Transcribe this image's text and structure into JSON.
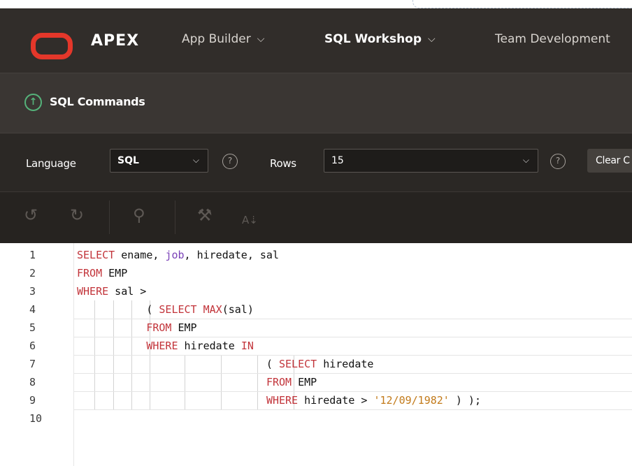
{
  "header": {
    "brand": "APEX",
    "nav": [
      {
        "label": "App Builder",
        "chevron": "⌵"
      },
      {
        "label": "SQL Workshop",
        "chevron": "⌵"
      },
      {
        "label": "Team Development"
      }
    ]
  },
  "breadcrumb": {
    "title": "SQL Commands",
    "icon": "arrow-up-circle-icon"
  },
  "toolbar": {
    "language_label": "Language",
    "language_value": "SQL",
    "rows_label": "Rows",
    "rows_value": "15",
    "clear_label": "Clear C",
    "help_glyph": "?"
  },
  "editor_toolbar": {
    "icons": [
      "undo-icon",
      "redo-icon",
      "search-icon",
      "hammer-icon",
      "sort-az-icon"
    ],
    "format_glyph": "A⇣"
  },
  "editor": {
    "lines": [
      {
        "n": "1",
        "segments": [
          [
            "kw",
            "SELECT"
          ],
          [
            "t",
            " ename, "
          ],
          [
            "col",
            "job"
          ],
          [
            "t",
            ", hiredate, sal"
          ]
        ]
      },
      {
        "n": "2",
        "segments": [
          [
            "kw",
            "FROM"
          ],
          [
            "t",
            " EMP"
          ]
        ]
      },
      {
        "n": "3",
        "segments": [
          [
            "kw",
            "WHERE"
          ],
          [
            "t",
            " sal >"
          ]
        ]
      },
      {
        "n": "4",
        "segments": [
          [
            "t",
            "           ( "
          ],
          [
            "kw",
            "SELECT"
          ],
          [
            "t",
            " "
          ],
          [
            "fn",
            "MAX"
          ],
          [
            "t",
            "(sal)"
          ]
        ]
      },
      {
        "n": "5",
        "segments": [
          [
            "t",
            "           "
          ],
          [
            "kw",
            "FROM"
          ],
          [
            "t",
            " EMP"
          ]
        ]
      },
      {
        "n": "6",
        "segments": [
          [
            "t",
            "           "
          ],
          [
            "kw",
            "WHERE"
          ],
          [
            "t",
            " hiredate "
          ],
          [
            "kw",
            "IN"
          ]
        ]
      },
      {
        "n": "7",
        "segments": [
          [
            "t",
            "                              ( "
          ],
          [
            "kw",
            "SELECT"
          ],
          [
            "t",
            " hiredate"
          ]
        ]
      },
      {
        "n": "8",
        "segments": [
          [
            "t",
            "                              "
          ],
          [
            "kw",
            "FROM"
          ],
          [
            "t",
            " EMP"
          ]
        ]
      },
      {
        "n": "9",
        "segments": [
          [
            "t",
            "                              "
          ],
          [
            "kw",
            "WHERE"
          ],
          [
            "t",
            " hiredate > "
          ],
          [
            "str",
            "'12/09/1982'"
          ],
          [
            "t",
            " ) );"
          ]
        ]
      },
      {
        "n": "10",
        "segments": []
      }
    ]
  },
  "colors": {
    "header_bg": "#312d2a",
    "subheader_bg": "#3a3633",
    "toolbar_bg": "#2b2825",
    "logo_red": "#e4372a",
    "accent_green": "#55b27a",
    "keyword": "#c2343a",
    "string": "#c27a1a",
    "column": "#7b42b8"
  }
}
